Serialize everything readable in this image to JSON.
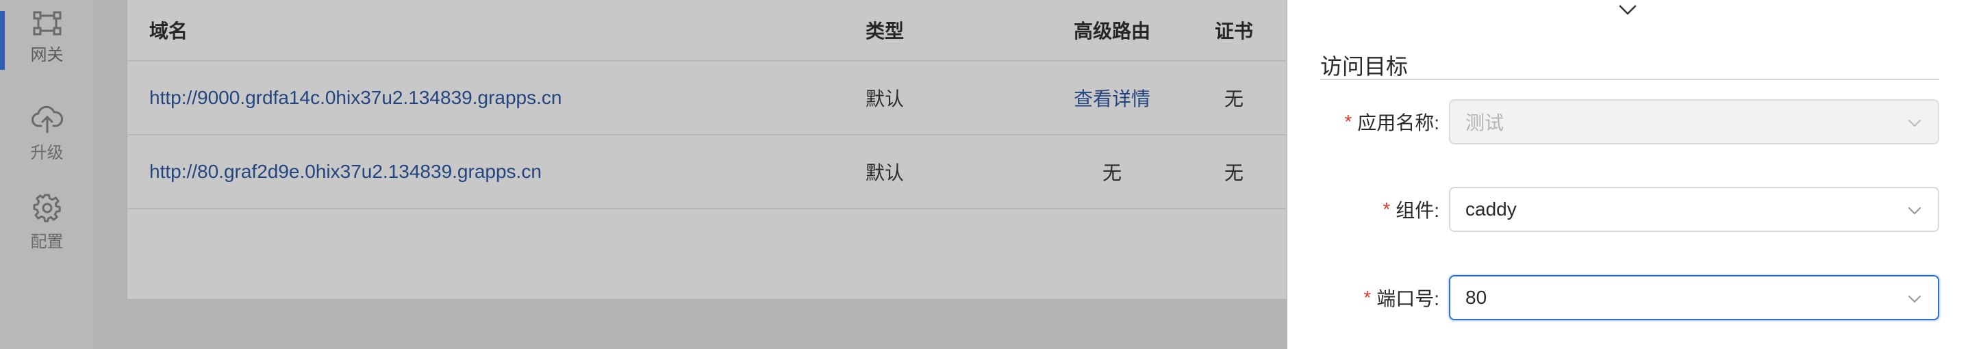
{
  "sidebar": {
    "items": [
      {
        "label": "网关",
        "icon": "gateway-icon",
        "active": true
      },
      {
        "label": "升级",
        "icon": "cloud-upload-icon",
        "active": false
      },
      {
        "label": "配置",
        "icon": "gear-icon",
        "active": false
      }
    ]
  },
  "table": {
    "headers": {
      "domain": "域名",
      "type": "类型",
      "route": "高级路由",
      "cert": "证书"
    },
    "rows": [
      {
        "domain": "http://9000.grdfa14c.0hix37u2.134839.grapps.cn",
        "type": "默认",
        "route": "查看详情",
        "cert": "无"
      },
      {
        "domain": "http://80.graf2d9e.0hix37u2.134839.grapps.cn",
        "type": "默认",
        "route": "无",
        "cert": "无"
      }
    ]
  },
  "drawer": {
    "section_title": "访问目标",
    "required_mark": "*",
    "fields": {
      "app_name": {
        "label": "应用名称:",
        "value": "测试",
        "disabled": true
      },
      "component": {
        "label": "组件:",
        "value": "caddy"
      },
      "port": {
        "label": "端口号:",
        "value": "80",
        "focused": true
      }
    }
  },
  "colors": {
    "accent": "#2f6ed8",
    "active_indicator": "#2f5fb0",
    "link": "#23457f",
    "required": "#e23b2e"
  }
}
